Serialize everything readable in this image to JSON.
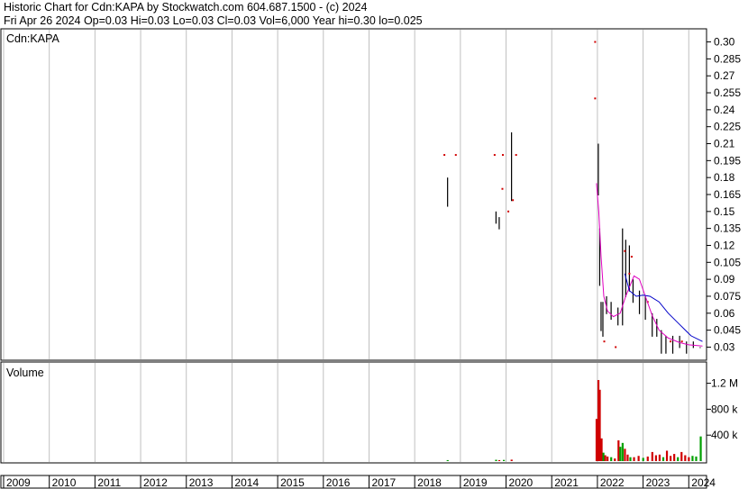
{
  "header": {
    "line1": "Historic Chart for Cdn:KAPA by Stockwatch.com 604.687.1500 - (c) 2024",
    "line2": "Fri Apr 26 2024   Op=0.03   Hi=0.03   Lo=0.03   Cl=0.03   Vol=6,000   Year hi=0.30   lo=0.025"
  },
  "price_panel": {
    "label": "Cdn:KAPA"
  },
  "volume_panel": {
    "label": "Volume"
  },
  "colors": {
    "ma_short": "#e000c0",
    "ma_long": "#0000c8",
    "up": "#00a000",
    "down": "#d00000",
    "grid": "#c0c0c0",
    "bar": "#000000"
  },
  "chart_data": [
    {
      "type": "ohlc",
      "title": "Cdn:KAPA",
      "ylim": [
        0.02,
        0.31
      ],
      "y_ticks": [
        0.3,
        0.285,
        0.27,
        0.255,
        0.24,
        0.225,
        0.21,
        0.195,
        0.18,
        0.165,
        0.15,
        0.135,
        0.12,
        0.105,
        0.09,
        0.075,
        0.06,
        0.045,
        0.03
      ],
      "y_tick_labels": [
        "0.30",
        "0.285",
        "0.27",
        "0.255",
        "0.24",
        "0.225",
        "0.21",
        "0.195",
        "0.18",
        "0.165",
        "0.15",
        "0.135",
        "0.12",
        "0.105",
        "0.09",
        "0.075",
        "0.06",
        "0.045",
        "0.03"
      ],
      "x_range": [
        2009,
        2024.33
      ],
      "bars": [
        {
          "t": 2018.72,
          "h": 0.18,
          "l": 0.155
        },
        {
          "t": 2019.78,
          "h": 0.15,
          "l": 0.14
        },
        {
          "t": 2019.85,
          "h": 0.145,
          "l": 0.135
        },
        {
          "t": 2020.12,
          "h": 0.22,
          "l": 0.16
        },
        {
          "t": 2022.02,
          "h": 0.21,
          "l": 0.165
        },
        {
          "t": 2022.05,
          "h": 0.135,
          "l": 0.085
        },
        {
          "t": 2022.08,
          "h": 0.07,
          "l": 0.045
        },
        {
          "t": 2022.12,
          "h": 0.07,
          "l": 0.04
        },
        {
          "t": 2022.2,
          "h": 0.075,
          "l": 0.06
        },
        {
          "t": 2022.3,
          "h": 0.07,
          "l": 0.055
        },
        {
          "t": 2022.45,
          "h": 0.065,
          "l": 0.05
        },
        {
          "t": 2022.55,
          "h": 0.135,
          "l": 0.05
        },
        {
          "t": 2022.62,
          "h": 0.125,
          "l": 0.075
        },
        {
          "t": 2022.7,
          "h": 0.12,
          "l": 0.08
        },
        {
          "t": 2022.78,
          "h": 0.09,
          "l": 0.07
        },
        {
          "t": 2022.92,
          "h": 0.08,
          "l": 0.06
        },
        {
          "t": 2023.05,
          "h": 0.075,
          "l": 0.055
        },
        {
          "t": 2023.2,
          "h": 0.06,
          "l": 0.04
        },
        {
          "t": 2023.3,
          "h": 0.055,
          "l": 0.04
        },
        {
          "t": 2023.4,
          "h": 0.045,
          "l": 0.025
        },
        {
          "t": 2023.5,
          "h": 0.04,
          "l": 0.025
        },
        {
          "t": 2023.65,
          "h": 0.04,
          "l": 0.025
        },
        {
          "t": 2023.8,
          "h": 0.04,
          "l": 0.03
        },
        {
          "t": 2023.95,
          "h": 0.035,
          "l": 0.025
        },
        {
          "t": 2024.1,
          "h": 0.035,
          "l": 0.03
        },
        {
          "t": 2024.25,
          "h": 0.03,
          "l": 0.03
        }
      ],
      "ticks_red": [
        {
          "t": 2018.65,
          "v": 0.2
        },
        {
          "t": 2018.9,
          "v": 0.2
        },
        {
          "t": 2019.75,
          "v": 0.2
        },
        {
          "t": 2019.93,
          "v": 0.2
        },
        {
          "t": 2020.22,
          "v": 0.2
        },
        {
          "t": 2019.92,
          "v": 0.17
        },
        {
          "t": 2020.15,
          "v": 0.16
        },
        {
          "t": 2020.05,
          "v": 0.15
        },
        {
          "t": 2021.95,
          "v": 0.3
        },
        {
          "t": 2021.95,
          "v": 0.25
        },
        {
          "t": 2022.6,
          "v": 0.115
        },
        {
          "t": 2022.75,
          "v": 0.11
        },
        {
          "t": 2022.7,
          "v": 0.095
        },
        {
          "t": 2022.15,
          "v": 0.035
        },
        {
          "t": 2022.4,
          "v": 0.03
        },
        {
          "t": 2023.1,
          "v": 0.07
        },
        {
          "t": 2023.6,
          "v": 0.035
        },
        {
          "t": 2023.85,
          "v": 0.035
        }
      ],
      "series": [
        {
          "kind": "ma_short",
          "points": [
            {
              "t": 2021.98,
              "v": 0.175
            },
            {
              "t": 2022.03,
              "v": 0.15
            },
            {
              "t": 2022.08,
              "v": 0.11
            },
            {
              "t": 2022.14,
              "v": 0.075
            },
            {
              "t": 2022.22,
              "v": 0.062
            },
            {
              "t": 2022.35,
              "v": 0.057
            },
            {
              "t": 2022.5,
              "v": 0.06
            },
            {
              "t": 2022.62,
              "v": 0.075
            },
            {
              "t": 2022.72,
              "v": 0.085
            },
            {
              "t": 2022.8,
              "v": 0.093
            },
            {
              "t": 2022.92,
              "v": 0.09
            },
            {
              "t": 2023.05,
              "v": 0.075
            },
            {
              "t": 2023.2,
              "v": 0.058
            },
            {
              "t": 2023.35,
              "v": 0.045
            },
            {
              "t": 2023.55,
              "v": 0.038
            },
            {
              "t": 2023.8,
              "v": 0.034
            },
            {
              "t": 2024.0,
              "v": 0.032
            },
            {
              "t": 2024.3,
              "v": 0.031
            }
          ]
        },
        {
          "kind": "ma_long",
          "points": [
            {
              "t": 2022.6,
              "v": 0.095
            },
            {
              "t": 2022.7,
              "v": 0.08
            },
            {
              "t": 2022.85,
              "v": 0.075
            },
            {
              "t": 2023.0,
              "v": 0.076
            },
            {
              "t": 2023.15,
              "v": 0.075
            },
            {
              "t": 2023.35,
              "v": 0.07
            },
            {
              "t": 2023.55,
              "v": 0.06
            },
            {
              "t": 2023.8,
              "v": 0.05
            },
            {
              "t": 2024.05,
              "v": 0.04
            },
            {
              "t": 2024.3,
              "v": 0.035
            }
          ]
        }
      ]
    },
    {
      "type": "bar",
      "title": "Volume",
      "ylim": [
        0,
        1500000
      ],
      "y_ticks": [
        400000,
        800000,
        1200000
      ],
      "y_tick_labels": [
        "400 k",
        "800 k",
        "1.2 M"
      ],
      "bars": [
        {
          "t": 2018.72,
          "v": 15000,
          "c": "up"
        },
        {
          "t": 2019.78,
          "v": 20000,
          "c": "up"
        },
        {
          "t": 2019.85,
          "v": 15000,
          "c": "down"
        },
        {
          "t": 2019.95,
          "v": 18000,
          "c": "up"
        },
        {
          "t": 2020.12,
          "v": 22000,
          "c": "down"
        },
        {
          "t": 2021.98,
          "v": 650000,
          "c": "down"
        },
        {
          "t": 2022.02,
          "v": 1250000,
          "c": "down"
        },
        {
          "t": 2022.05,
          "v": 1100000,
          "c": "down"
        },
        {
          "t": 2022.09,
          "v": 350000,
          "c": "down"
        },
        {
          "t": 2022.13,
          "v": 130000,
          "c": "up"
        },
        {
          "t": 2022.17,
          "v": 90000,
          "c": "down"
        },
        {
          "t": 2022.22,
          "v": 70000,
          "c": "down"
        },
        {
          "t": 2022.3,
          "v": 60000,
          "c": "up"
        },
        {
          "t": 2022.38,
          "v": 40000,
          "c": "down"
        },
        {
          "t": 2022.46,
          "v": 320000,
          "c": "down"
        },
        {
          "t": 2022.5,
          "v": 220000,
          "c": "up"
        },
        {
          "t": 2022.55,
          "v": 280000,
          "c": "up"
        },
        {
          "t": 2022.6,
          "v": 190000,
          "c": "down"
        },
        {
          "t": 2022.66,
          "v": 100000,
          "c": "down"
        },
        {
          "t": 2022.72,
          "v": 60000,
          "c": "up"
        },
        {
          "t": 2022.8,
          "v": 60000,
          "c": "down"
        },
        {
          "t": 2022.9,
          "v": 80000,
          "c": "down"
        },
        {
          "t": 2023.0,
          "v": 50000,
          "c": "up"
        },
        {
          "t": 2023.1,
          "v": 70000,
          "c": "down"
        },
        {
          "t": 2023.2,
          "v": 140000,
          "c": "down"
        },
        {
          "t": 2023.28,
          "v": 90000,
          "c": "down"
        },
        {
          "t": 2023.36,
          "v": 100000,
          "c": "down"
        },
        {
          "t": 2023.44,
          "v": 60000,
          "c": "up"
        },
        {
          "t": 2023.52,
          "v": 160000,
          "c": "down"
        },
        {
          "t": 2023.6,
          "v": 80000,
          "c": "down"
        },
        {
          "t": 2023.68,
          "v": 110000,
          "c": "down"
        },
        {
          "t": 2023.76,
          "v": 60000,
          "c": "up"
        },
        {
          "t": 2023.84,
          "v": 140000,
          "c": "down"
        },
        {
          "t": 2023.92,
          "v": 90000,
          "c": "down"
        },
        {
          "t": 2024.0,
          "v": 60000,
          "c": "down"
        },
        {
          "t": 2024.08,
          "v": 80000,
          "c": "up"
        },
        {
          "t": 2024.16,
          "v": 70000,
          "c": "up"
        },
        {
          "t": 2024.26,
          "v": 380000,
          "c": "up"
        }
      ]
    }
  ],
  "x_axis": {
    "years": [
      "2009",
      "2010",
      "2011",
      "2012",
      "2013",
      "2014",
      "2015",
      "2016",
      "2017",
      "2018",
      "2019",
      "2020",
      "2021",
      "2022",
      "2023",
      "2024"
    ]
  }
}
